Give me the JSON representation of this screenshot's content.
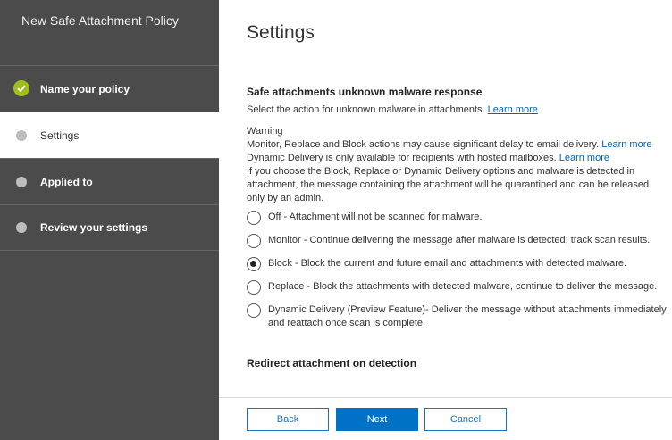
{
  "sidebar": {
    "title": "New Safe Attachment Policy",
    "steps": [
      {
        "label": "Name your policy",
        "state": "complete"
      },
      {
        "label": "Settings",
        "state": "active"
      },
      {
        "label": "Applied to",
        "state": "pending"
      },
      {
        "label": "Review your settings",
        "state": "pending"
      }
    ]
  },
  "main": {
    "title": "Settings",
    "section1": {
      "heading": "Safe attachments unknown malware response",
      "description": "Select the action for unknown malware in attachments.",
      "learn_more": "Learn more",
      "warning_label": "Warning",
      "warning_line1": "Monitor, Replace and Block actions may cause significant delay to email delivery.",
      "warning_line1_link": "Learn more",
      "warning_line2": "Dynamic Delivery is only available for recipients with hosted mailboxes.",
      "warning_line2_link": "Learn more",
      "warning_line3": "If you choose the Block, Replace or Dynamic Delivery options and malware is detected in attachment, the message containing the attachment will be quarantined and can be released only by an admin."
    },
    "options": [
      {
        "label": "Off - Attachment will not be scanned for malware.",
        "selected": false
      },
      {
        "label": "Monitor - Continue delivering the message after malware is detected; track scan results.",
        "selected": false
      },
      {
        "label": "Block - Block the current and future email and attachments with detected malware.",
        "selected": true
      },
      {
        "label": "Replace - Block the attachments with detected malware, continue to deliver the message.",
        "selected": false
      },
      {
        "label": "Dynamic Delivery (Preview Feature)- Deliver the message without attachments immediately and reattach once scan is complete.",
        "selected": false
      }
    ],
    "section2": {
      "heading": "Redirect attachment on detection"
    }
  },
  "footer": {
    "back_label": "Back",
    "next_label": "Next",
    "cancel_label": "Cancel"
  }
}
